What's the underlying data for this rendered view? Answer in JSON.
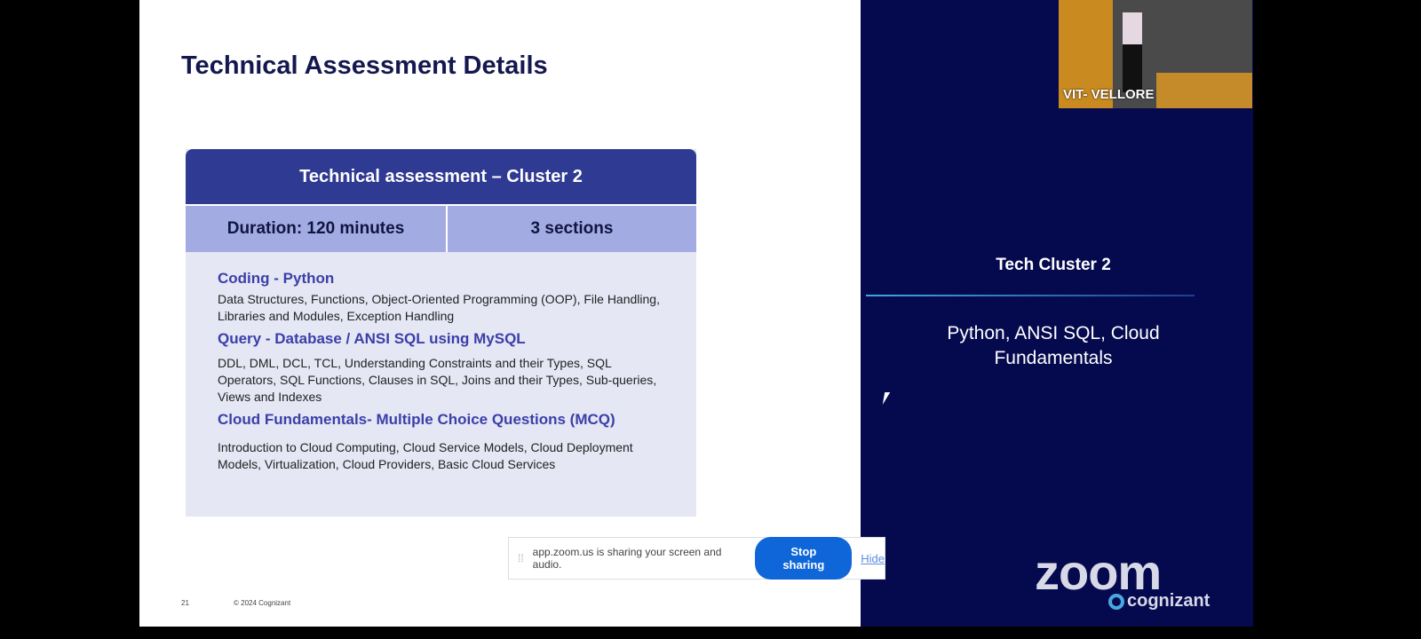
{
  "slide": {
    "title": "Technical Assessment Details",
    "card": {
      "header": "Technical assessment – Cluster 2",
      "duration": "Duration: 120 minutes",
      "sections_count": "3 sections",
      "sections": [
        {
          "heading": "Coding - Python",
          "desc": "Data Structures, Functions, Object-Oriented Programming (OOP), File Handling, Libraries and Modules, Exception Handling"
        },
        {
          "heading": "Query - Database / ANSI SQL using MySQL",
          "desc": "DDL, DML, DCL, TCL, Understanding Constraints and their Types, SQL Operators, SQL Functions, Clauses in SQL, Joins and their Types, Sub-queries, Views and Indexes"
        },
        {
          "heading": "Cloud Fundamentals- Multiple Choice Questions (MCQ)",
          "desc": "Introduction to Cloud Computing, Cloud Service Models, Cloud Deployment Models, Virtualization, Cloud Providers, Basic Cloud Services"
        }
      ]
    },
    "page_number": "21",
    "copyright": "© 2024 Cognizant"
  },
  "panel": {
    "title": "Tech Cluster 2",
    "description": "Python, ANSI SQL, Cloud Fundamentals",
    "video_label": "VIT- VELLORE",
    "logo_zoom": "zoom",
    "logo_cognizant": "cognizant"
  },
  "share_bar": {
    "message": "app.zoom.us is sharing your screen and audio.",
    "stop_label": "Stop sharing",
    "hide_label": "Hide"
  },
  "colors": {
    "navy": "#050a4f",
    "card_header": "#2f3b93",
    "stop_button": "#0e66d8"
  }
}
